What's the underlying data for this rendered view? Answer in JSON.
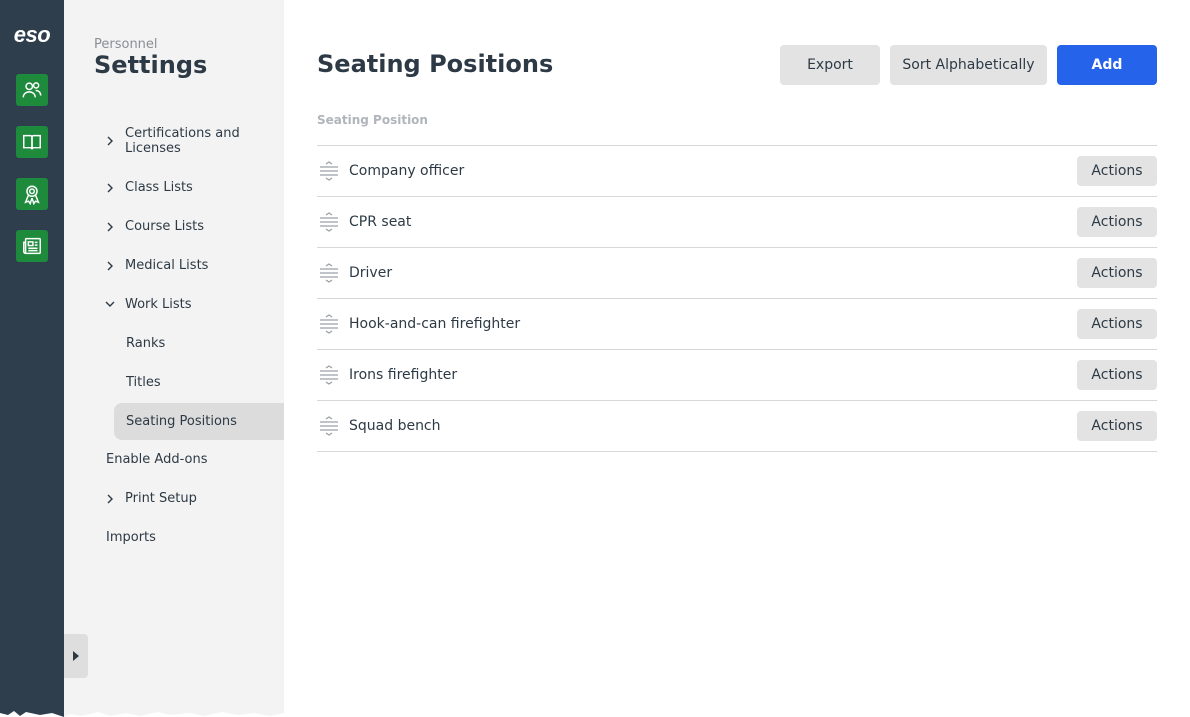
{
  "rail": {
    "logo": "eso",
    "items": [
      {
        "icon": "people-icon"
      },
      {
        "icon": "book-icon"
      },
      {
        "icon": "award-icon"
      },
      {
        "icon": "news-icon"
      }
    ]
  },
  "sidebar": {
    "breadcrumb": "Personnel",
    "title": "Settings",
    "items": [
      {
        "label": "Certifications and Licenses",
        "expandable": true
      },
      {
        "label": "Class Lists",
        "expandable": true
      },
      {
        "label": "Course Lists",
        "expandable": true
      },
      {
        "label": "Medical Lists",
        "expandable": true
      },
      {
        "label": "Work Lists",
        "expandable": true,
        "expanded": true
      },
      {
        "label": "Enable Add-ons",
        "expandable": false
      },
      {
        "label": "Print Setup",
        "expandable": true
      },
      {
        "label": "Imports",
        "expandable": false
      }
    ],
    "work_lists_children": [
      {
        "label": "Ranks"
      },
      {
        "label": "Titles"
      },
      {
        "label": "Seating Positions",
        "selected": true
      }
    ]
  },
  "main": {
    "title": "Seating Positions",
    "buttons": {
      "export": "Export",
      "sort": "Sort Alphabetically",
      "add": "Add"
    },
    "column_header": "Seating Position",
    "rows": [
      {
        "label": "Company officer",
        "action": "Actions"
      },
      {
        "label": "CPR seat",
        "action": "Actions"
      },
      {
        "label": "Driver",
        "action": "Actions"
      },
      {
        "label": "Hook-and-can firefighter",
        "action": "Actions"
      },
      {
        "label": "Irons firefighter",
        "action": "Actions"
      },
      {
        "label": "Squad bench",
        "action": "Actions"
      }
    ]
  },
  "colors": {
    "rail": "#2e3e4d",
    "rail_icon_bg": "#1e8a3c",
    "primary": "#2563eb",
    "sidebar_bg": "#f3f3f3",
    "selected_bg": "#dcdcdc"
  }
}
